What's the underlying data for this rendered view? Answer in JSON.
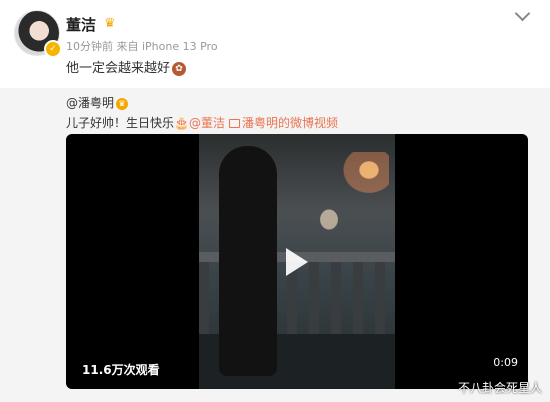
{
  "post": {
    "username": "董洁",
    "meta": "10分钟前 来自 iPhone 13 Pro",
    "text": "他一定会越来越好"
  },
  "repost": {
    "mention": "@潘粤明",
    "text_prefix": "儿子好帅！生日快乐",
    "at_link": "@董洁",
    "video_link": "潘粤明的微博视频"
  },
  "video": {
    "views": "11.6万次观看",
    "duration": "0:09"
  },
  "watermark": "不八卦会死星人",
  "icons": {
    "crown": "crown-icon",
    "verify": "verify-badge-icon",
    "cake": "cake-emoji-icon",
    "play": "play-button-icon",
    "menu": "chevron-down-icon"
  },
  "colors": {
    "link": "#eb7350",
    "badge": "#f3a700",
    "repost_bg": "#f4f4f4"
  }
}
